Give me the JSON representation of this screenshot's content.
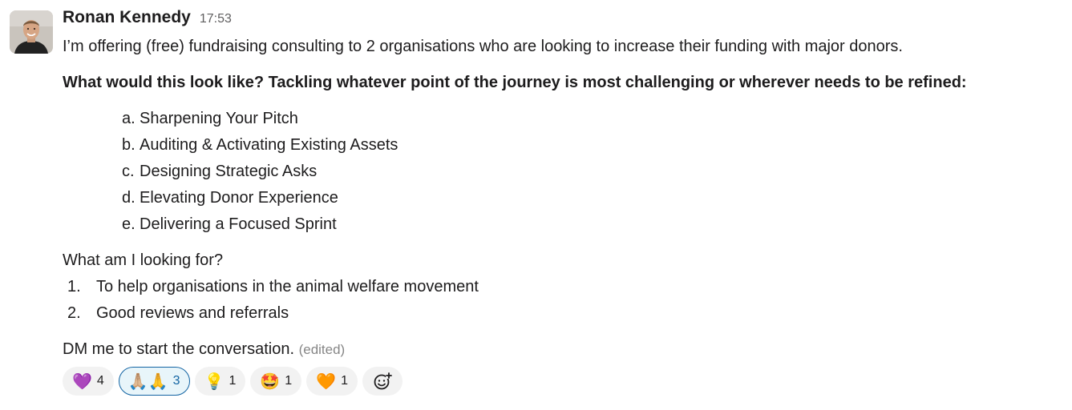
{
  "sender": "Ronan Kennedy",
  "timestamp": "17:53",
  "message": {
    "intro": "I’m offering (free) fundraising consulting to 2 organisations who are looking to increase their funding with major donors.",
    "question": "What would this look like? Tackling whatever point of the journey is most challenging or wherever needs to be refined:",
    "offer_items": [
      {
        "marker": "a.",
        "text": "Sharpening Your Pitch"
      },
      {
        "marker": "b.",
        "text": "Auditing & Activating Existing Assets"
      },
      {
        "marker": "c.",
        "text": "Designing Strategic Asks"
      },
      {
        "marker": "d.",
        "text": "Elevating Donor Experience"
      },
      {
        "marker": "e.",
        "text": "Delivering a Focused Sprint"
      }
    ],
    "looking_for_heading": "What am I looking for?",
    "looking_for_items": [
      {
        "marker": "1.",
        "text": "To help organisations in the animal welfare movement"
      },
      {
        "marker": "2.",
        "text": "Good reviews and referrals"
      }
    ],
    "cta": "DM me to start the conversation.",
    "edited_label": "(edited)"
  },
  "reactions": [
    {
      "icon": "purple-heart-icon",
      "emoji": "💜",
      "count": "4",
      "active": false
    },
    {
      "icon": "folded-hands-icon",
      "emoji": "🙏🏼🙏",
      "count": "3",
      "active": true
    },
    {
      "icon": "light-bulb-icon",
      "emoji": "💡",
      "count": "1",
      "active": false
    },
    {
      "icon": "star-struck-icon",
      "emoji": "🤩",
      "count": "1",
      "active": false
    },
    {
      "icon": "orange-heart-icon",
      "emoji": "🧡",
      "count": "1",
      "active": false
    }
  ],
  "add_reaction_icon": "add-reaction-icon",
  "colors": {
    "text": "#1d1c1d",
    "timestamp": "#616061",
    "edited": "#868686",
    "reaction_bg": "#f2f2f2",
    "reaction_active_bg": "#e8f5fa",
    "reaction_active_border": "#1264a3"
  }
}
